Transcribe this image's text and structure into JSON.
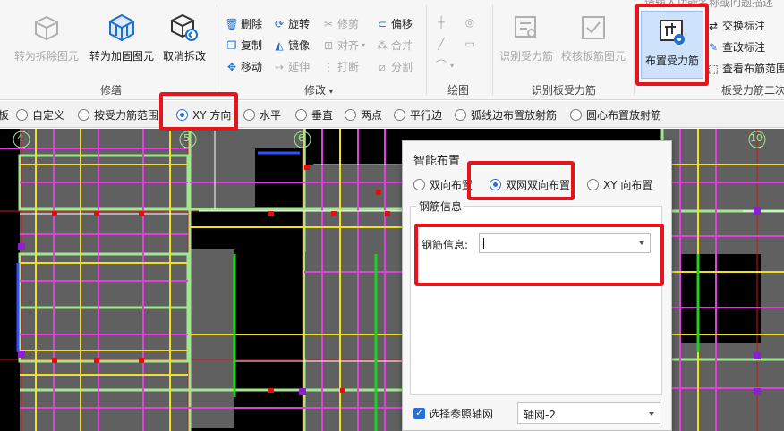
{
  "ribbon": {
    "search_hint": "请输入功能名称或问题描述",
    "group_edit": {
      "label": "修缮",
      "buttons": [
        {
          "label": "转为拆除图元",
          "icon": "cube-split-icon",
          "enabled": false
        },
        {
          "label": "转为加固图元",
          "icon": "cube-reinforce-icon",
          "enabled": true
        },
        {
          "label": "取消拆改",
          "icon": "cube-undo-icon",
          "enabled": true
        }
      ]
    },
    "group_modify": {
      "label": "修改",
      "items": [
        {
          "label": "删除",
          "icon": "trash-icon",
          "enabled": true
        },
        {
          "label": "旋转",
          "icon": "rotate-icon",
          "enabled": true
        },
        {
          "label": "修剪",
          "icon": "trim-icon",
          "enabled": false
        },
        {
          "label": "偏移",
          "icon": "offset-icon",
          "enabled": true
        },
        {
          "label": "复制",
          "icon": "copy-icon",
          "enabled": true
        },
        {
          "label": "镜像",
          "icon": "mirror-icon",
          "enabled": true
        },
        {
          "label": "对齐",
          "icon": "align-icon",
          "enabled": false
        },
        {
          "label": "合并",
          "icon": "merge-icon",
          "enabled": false
        },
        {
          "label": "移动",
          "icon": "move-icon",
          "enabled": true
        },
        {
          "label": "延伸",
          "icon": "extend-icon",
          "enabled": false
        },
        {
          "label": "打断",
          "icon": "break-icon",
          "enabled": false
        },
        {
          "label": "分割",
          "icon": "split-icon",
          "enabled": false
        }
      ]
    },
    "group_draw": {
      "label": "绘图"
    },
    "group_identify": {
      "label": "识别板受力筋",
      "buttons": [
        {
          "label": "识别受力筋",
          "icon": "identify-rebar-icon",
          "enabled": false
        },
        {
          "label": "校核板筋图元",
          "icon": "check-rebar-icon",
          "enabled": false
        }
      ]
    },
    "group_rebar": {
      "label": "板受力筋二次",
      "main_button": {
        "label": "布置受力筋",
        "icon": "place-rebar-icon"
      },
      "items": [
        {
          "label": "交换标注",
          "icon": "swap-label-icon"
        },
        {
          "label": "查改标注",
          "icon": "edit-label-icon"
        },
        {
          "label": "查看布筋范围",
          "icon": "view-range-icon"
        }
      ]
    }
  },
  "options": [
    {
      "label": "板",
      "selected": false,
      "has_radio": false
    },
    {
      "label": "自定义",
      "selected": false,
      "has_radio": true
    },
    {
      "label": "按受力筋范围",
      "selected": false,
      "has_radio": true
    },
    {
      "label": "XY 方向",
      "selected": true,
      "has_radio": true
    },
    {
      "label": "水平",
      "selected": false,
      "has_radio": true
    },
    {
      "label": "垂直",
      "selected": false,
      "has_radio": true
    },
    {
      "label": "两点",
      "selected": false,
      "has_radio": true
    },
    {
      "label": "平行边",
      "selected": false,
      "has_radio": true
    },
    {
      "label": "弧线边布置放射筋",
      "selected": false,
      "has_radio": true
    },
    {
      "label": "圆心布置放射筋",
      "selected": false,
      "has_radio": true
    }
  ],
  "canvas": {
    "axis_labels": [
      "4",
      "5",
      "6",
      "10"
    ]
  },
  "dialog": {
    "title": "智能布置",
    "layout_modes": [
      {
        "label": "双向布置",
        "selected": false
      },
      {
        "label": "双网双向布置",
        "selected": true
      },
      {
        "label": "XY 向布置",
        "selected": false
      }
    ],
    "group_title": "钢筋信息",
    "rebar_info_label": "钢筋信息:",
    "rebar_info_value": "",
    "ref_grid_checkbox_label": "选择参照轴网",
    "ref_grid_checked": true,
    "ref_grid_value": "轴网-2"
  },
  "colors": {
    "highlight_red": "#e8141b",
    "accent_blue": "#2b6fd6",
    "canvas_bg": "#000000"
  }
}
